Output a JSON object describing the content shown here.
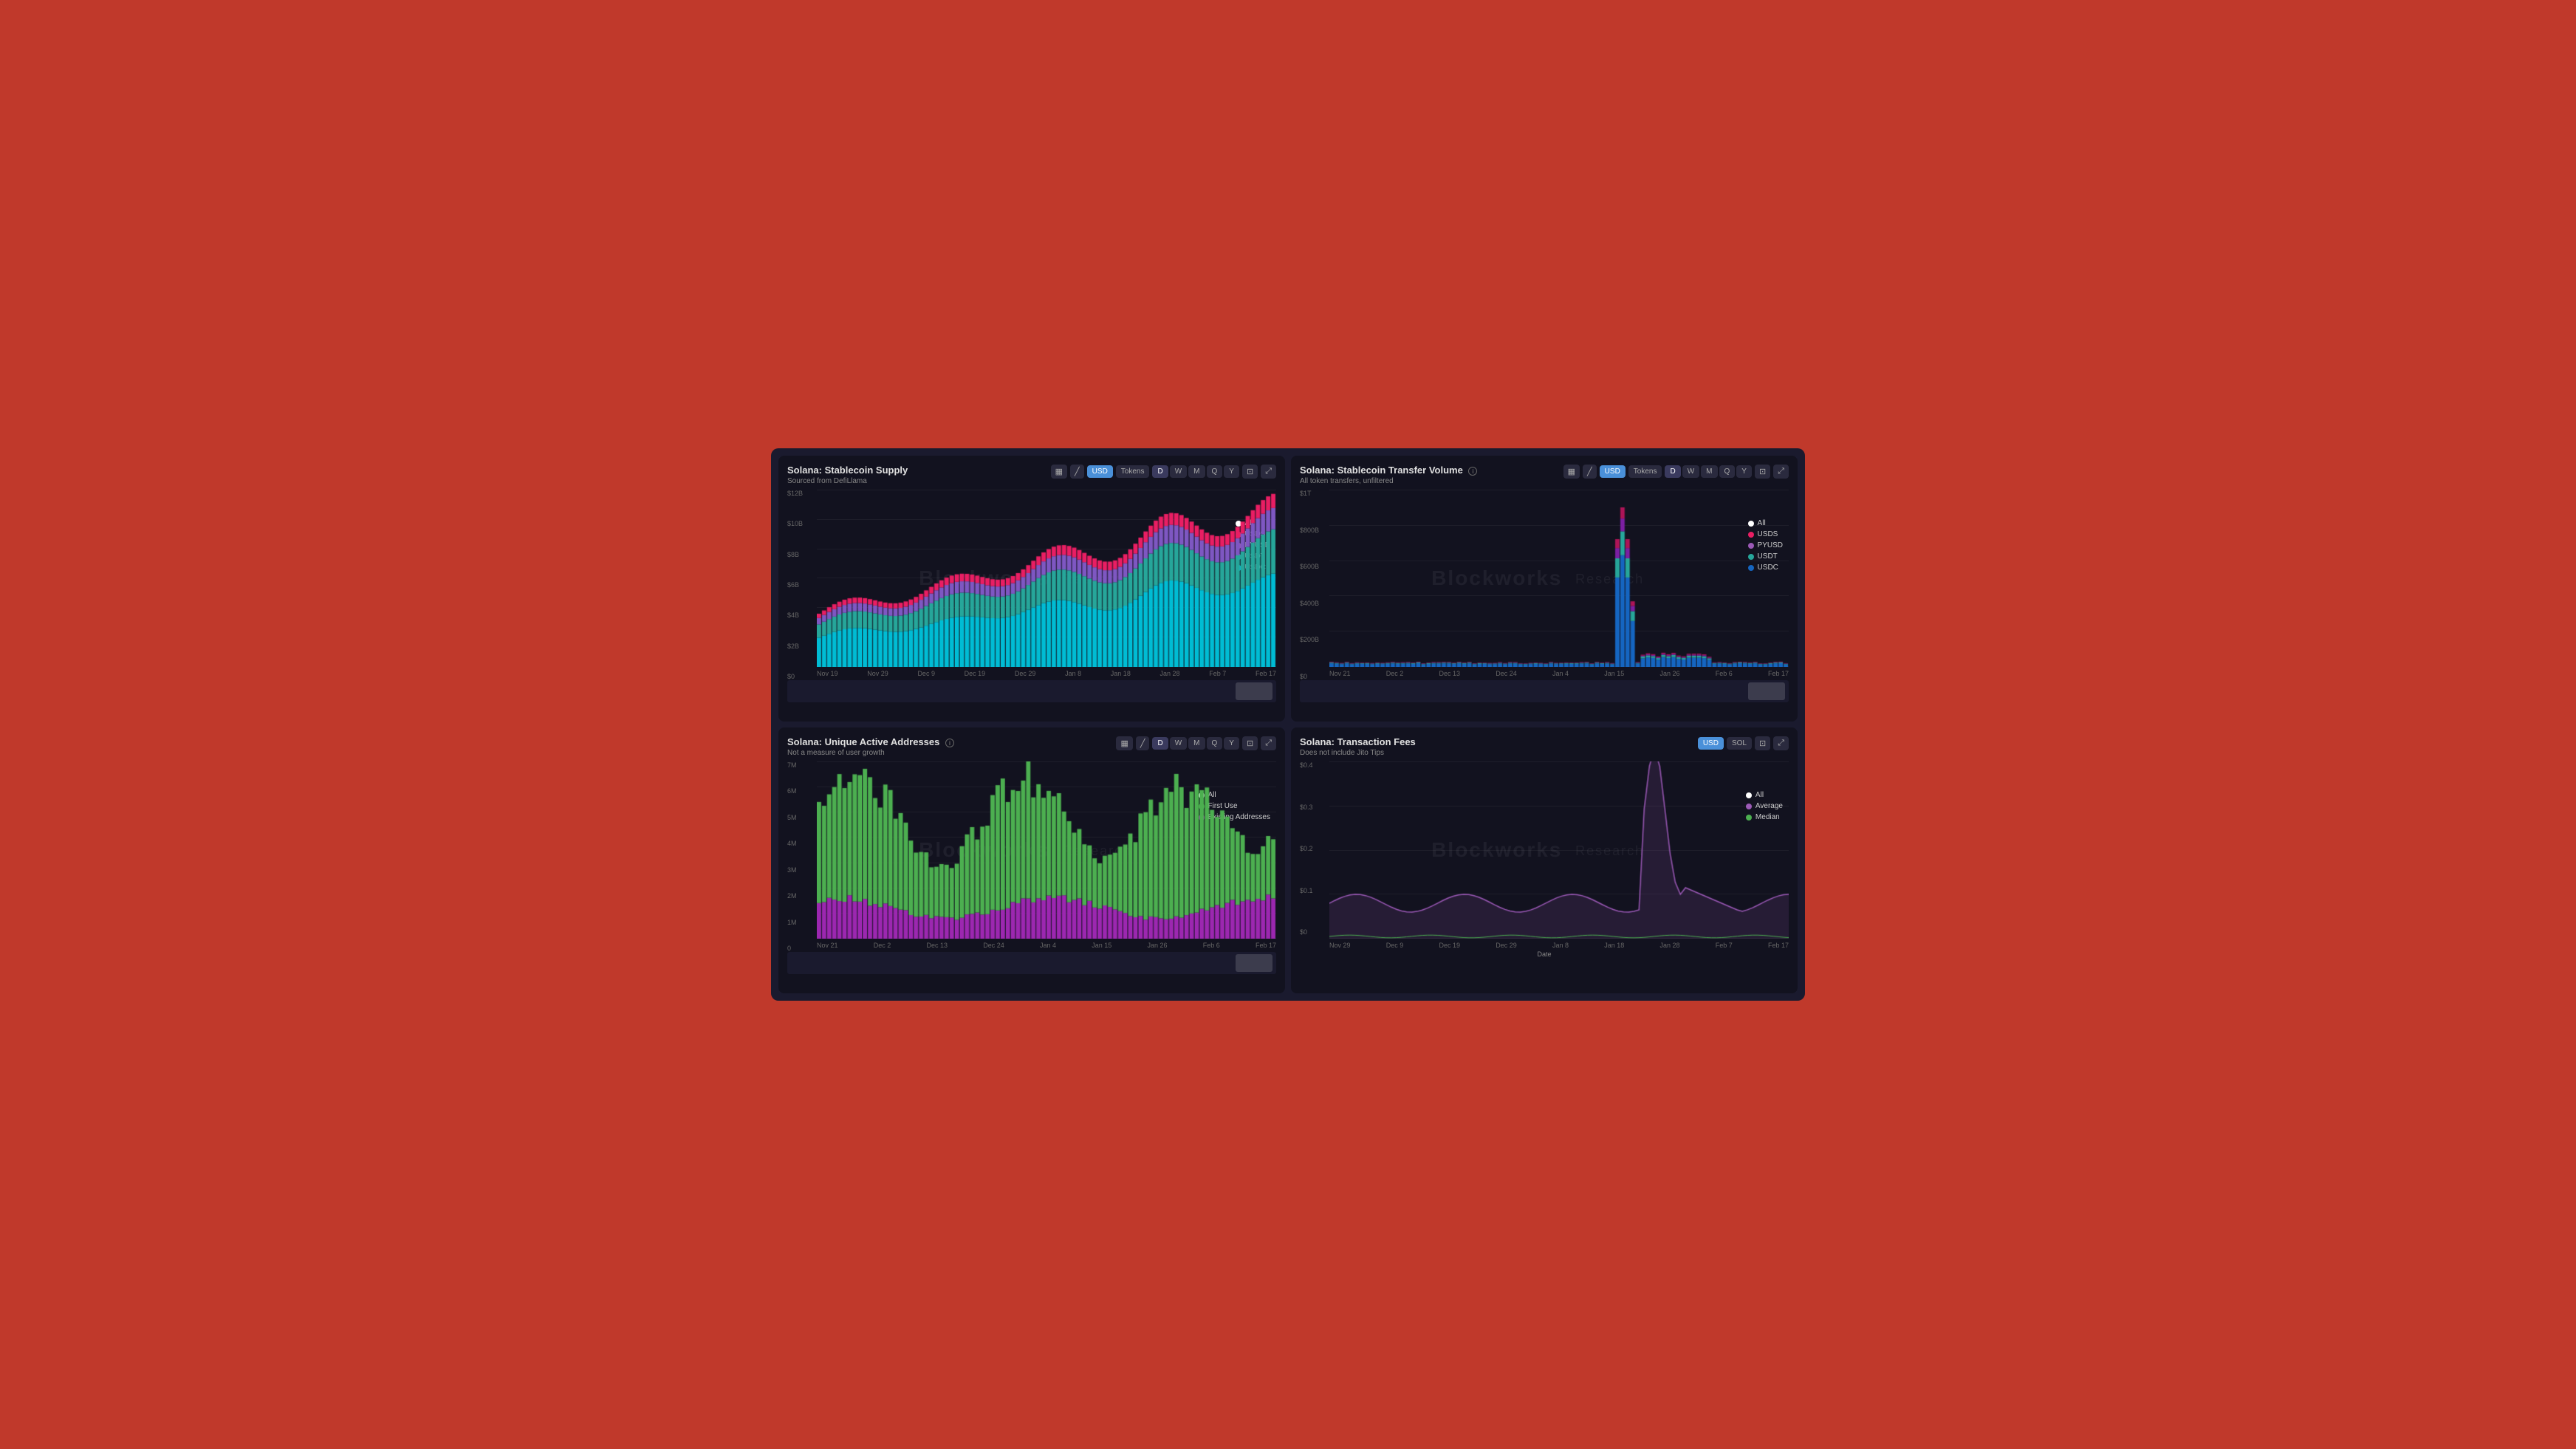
{
  "dashboard": {
    "panels": [
      {
        "id": "stablecoin-supply",
        "title": "Solana: Stablecoin Supply",
        "subtitle": "Sourced from DefiLlama",
        "hasInfo": false,
        "controls": {
          "unit_options": [
            "USD",
            "Tokens"
          ],
          "active_unit": "USD",
          "time_options": [
            "D",
            "W",
            "M",
            "Q",
            "Y"
          ],
          "active_time": "D"
        },
        "legend": [
          {
            "label": "All",
            "color": "#ffffff",
            "type": "circle"
          },
          {
            "label": "USDS",
            "color": "#e91e63",
            "type": "circle"
          },
          {
            "label": "PYUSD",
            "color": "#9b59b6",
            "type": "circle"
          },
          {
            "label": "USDT",
            "color": "#26a69a",
            "type": "circle"
          },
          {
            "label": "USDC",
            "color": "#00bcd4",
            "type": "circle"
          }
        ],
        "y_axis": [
          "$12B",
          "$10B",
          "$8B",
          "$6B",
          "$4B",
          "$2B",
          "$0"
        ],
        "x_axis": [
          "Nov 19",
          "Nov 29",
          "Dec 9",
          "Dec 19",
          "Dec 29",
          "Jan 8",
          "Jan 18",
          "Jan 28",
          "Feb 7",
          "Feb 17"
        ],
        "watermark": "Blockworks",
        "watermark_sub": "Research"
      },
      {
        "id": "stablecoin-transfer",
        "title": "Solana: Stablecoin Transfer Volume",
        "subtitle": "All token transfers, unfiltered",
        "hasInfo": true,
        "controls": {
          "unit_options": [
            "USD",
            "Tokens"
          ],
          "active_unit": "USD",
          "time_options": [
            "D",
            "W",
            "M",
            "Q",
            "Y"
          ],
          "active_time": "D"
        },
        "legend": [
          {
            "label": "All",
            "color": "#ffffff",
            "type": "circle"
          },
          {
            "label": "USDS",
            "color": "#e91e63",
            "type": "circle"
          },
          {
            "label": "PYUSD",
            "color": "#9b59b6",
            "type": "circle"
          },
          {
            "label": "USDT",
            "color": "#26a69a",
            "type": "circle"
          },
          {
            "label": "USDC",
            "color": "#1565c0",
            "type": "circle"
          }
        ],
        "y_axis": [
          "$1T",
          "$800B",
          "$600B",
          "$400B",
          "$200B",
          "$0"
        ],
        "x_axis": [
          "Nov 21",
          "Dec 2",
          "Dec 13",
          "Dec 24",
          "Jan 4",
          "Jan 15",
          "Jan 26",
          "Feb 6",
          "Feb 17"
        ],
        "watermark": "Blockworks",
        "watermark_sub": "Research"
      },
      {
        "id": "unique-active-addresses",
        "title": "Solana: Unique Active Addresses",
        "subtitle": "Not a measure of user growth",
        "hasInfo": true,
        "controls": {
          "unit_options": [],
          "time_options": [
            "D",
            "W",
            "M",
            "Q",
            "Y"
          ],
          "active_time": "D"
        },
        "legend": [
          {
            "label": "All",
            "color": "#ffffff",
            "type": "circle"
          },
          {
            "label": "First Use",
            "color": "#4caf50",
            "type": "circle"
          },
          {
            "label": "Existing Addresses",
            "color": "#9c27b0",
            "type": "circle"
          }
        ],
        "y_axis": [
          "7M",
          "6M",
          "5M",
          "4M",
          "3M",
          "2M",
          "1M",
          "0"
        ],
        "x_axis": [
          "Nov 21",
          "Dec 2",
          "Dec 13",
          "Dec 24",
          "Jan 4",
          "Jan 15",
          "Jan 26",
          "Feb 6",
          "Feb 17"
        ],
        "watermark": "Blockworks",
        "watermark_sub": "Research"
      },
      {
        "id": "transaction-fees",
        "title": "Solana: Transaction Fees",
        "subtitle": "Does not include Jito Tips",
        "hasInfo": false,
        "controls": {
          "unit_options": [
            "USD",
            "SOL"
          ],
          "active_unit": "USD",
          "time_options": [],
          "active_time": ""
        },
        "legend": [
          {
            "label": "All",
            "color": "#ffffff",
            "type": "circle"
          },
          {
            "label": "Average",
            "color": "#9b59b6",
            "type": "circle"
          },
          {
            "label": "Median",
            "color": "#4caf50",
            "type": "circle"
          }
        ],
        "y_axis": [
          "$0.4",
          "$0.3",
          "$0.2",
          "$0.1",
          "$0"
        ],
        "x_axis": [
          "Nov 29",
          "Dec 9",
          "Dec 19",
          "Dec 29",
          "Jan 8",
          "Jan 18",
          "Jan 28",
          "Feb 7",
          "Feb 17"
        ],
        "x_label": "Date",
        "watermark": "Blockworks",
        "watermark_sub": "Research"
      }
    ]
  }
}
